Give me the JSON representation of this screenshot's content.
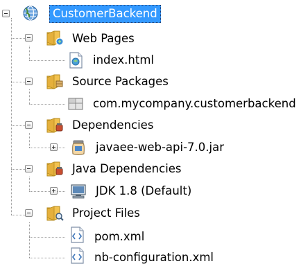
{
  "tree": {
    "root": {
      "label": "CustomerBackend",
      "icon": "globe-project-icon",
      "expanded": true,
      "selected": true
    },
    "nodes": [
      {
        "label": "Web Pages",
        "icon": "web-pages-folder-icon",
        "expanded": true,
        "children": [
          {
            "label": "index.html",
            "icon": "html-file-icon"
          }
        ]
      },
      {
        "label": "Source Packages",
        "icon": "source-packages-folder-icon",
        "expanded": true,
        "children": [
          {
            "label": "com.mycompany.customerbackend",
            "icon": "package-icon"
          }
        ]
      },
      {
        "label": "Dependencies",
        "icon": "dependencies-folder-icon",
        "expanded": true,
        "children": [
          {
            "label": "javaee-web-api-7.0.jar",
            "icon": "jar-icon",
            "expanded": false
          }
        ]
      },
      {
        "label": "Java Dependencies",
        "icon": "java-dependencies-folder-icon",
        "expanded": true,
        "children": [
          {
            "label": "JDK 1.8 (Default)",
            "icon": "jdk-icon",
            "expanded": false
          }
        ]
      },
      {
        "label": "Project Files",
        "icon": "project-files-folder-icon",
        "expanded": true,
        "children": [
          {
            "label": "pom.xml",
            "icon": "xml-file-icon"
          },
          {
            "label": "nb-configuration.xml",
            "icon": "xml-file-icon"
          }
        ]
      }
    ]
  },
  "colors": {
    "selection": "#3399ff",
    "folder": "#f2c24f",
    "guide_line": "#9a9a9a"
  }
}
